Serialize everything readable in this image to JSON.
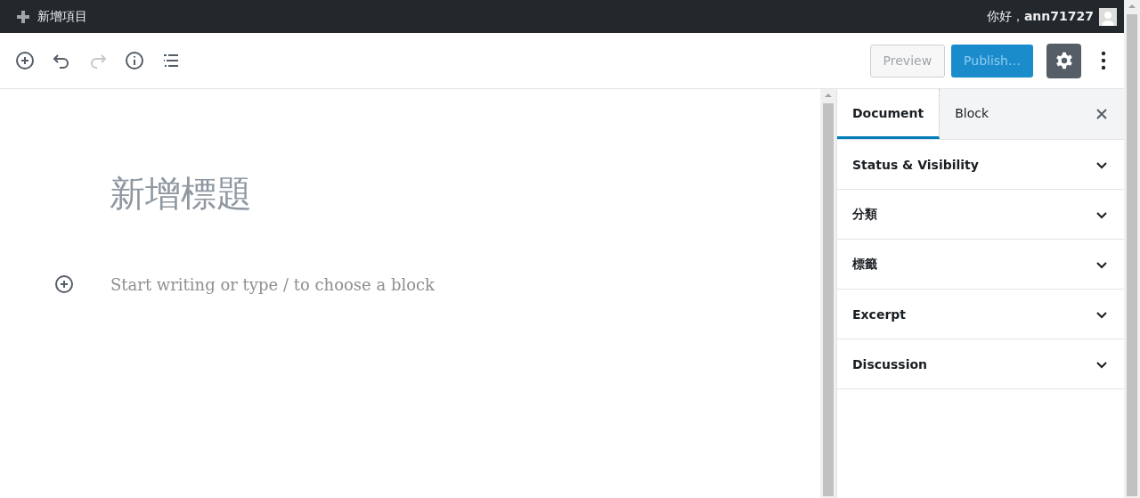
{
  "admin_bar": {
    "new_item": "新增項目",
    "greeting": "你好，**ann71727**"
  },
  "toolbar": {
    "tools": [
      {
        "kind": "add",
        "disabled": false
      },
      {
        "kind": "undo",
        "disabled": false
      },
      {
        "kind": "redo",
        "disabled": true
      },
      {
        "kind": "info",
        "disabled": false
      },
      {
        "kind": "outline",
        "disabled": false
      }
    ],
    "preview": "Preview",
    "publish": "Publish…",
    "settings": {
      "selected": true
    }
  },
  "editor": {
    "title_placeholder": "新增標題",
    "body_placeholder": "Start writing or type / to choose a block"
  },
  "sidebar": {
    "tabs": [
      {
        "label": "Document",
        "selected": true
      },
      {
        "label": "Block",
        "selected": false
      }
    ],
    "panels": [
      {
        "label": "Status & Visibility",
        "expanded": false
      },
      {
        "label": "分類",
        "expanded": false
      },
      {
        "label": "標籤",
        "expanded": false
      },
      {
        "label": "Excerpt",
        "expanded": false
      },
      {
        "label": "Discussion",
        "expanded": false
      }
    ]
  }
}
